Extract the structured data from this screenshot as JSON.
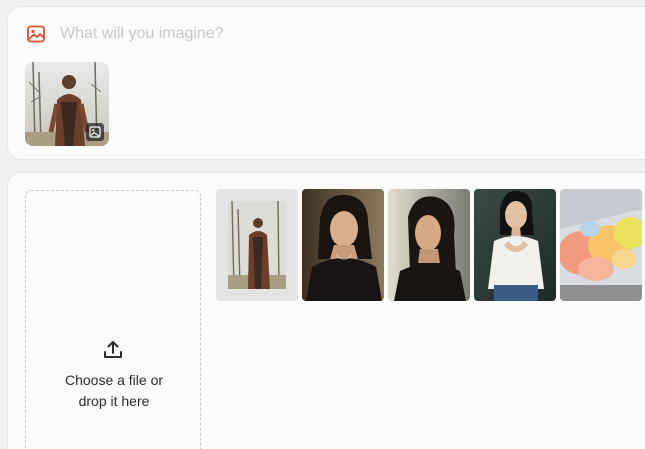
{
  "prompt": {
    "placeholder": "What will you imagine?",
    "input_icon": "image-icon",
    "reference_image": {
      "badge_icon": "image-reference-icon"
    }
  },
  "upload": {
    "icon": "upload-icon",
    "line1": "Choose a file or",
    "line2": "drop it here"
  },
  "gallery": [
    {
      "name": "gallery-thumb-woman-forest"
    },
    {
      "name": "gallery-thumb-portrait-black-dress"
    },
    {
      "name": "gallery-thumb-portrait-side-light"
    },
    {
      "name": "gallery-thumb-seated-white-top"
    },
    {
      "name": "gallery-thumb-color-smoke"
    }
  ],
  "colors": {
    "accent": "#d9532b",
    "placeholder": "#c8c8c8",
    "card_bg": "#fbfbfb",
    "page_bg": "#f1f1f1",
    "text": "#2b2b2b"
  }
}
